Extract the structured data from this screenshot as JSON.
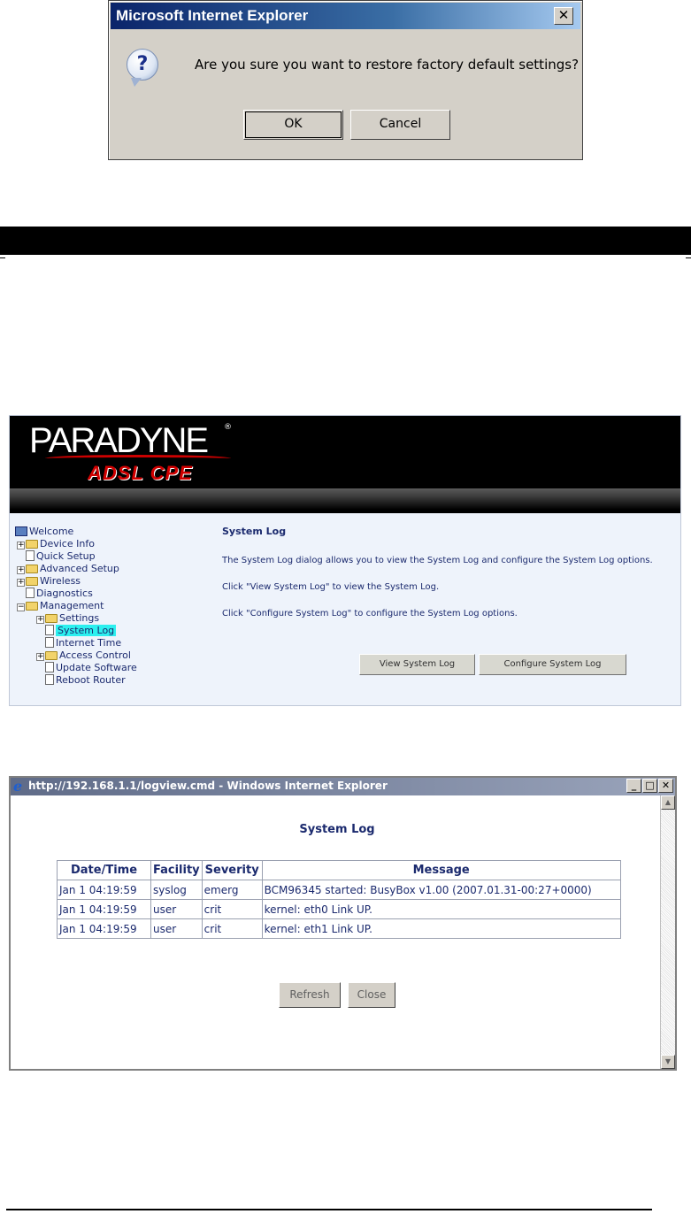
{
  "confirm_dialog": {
    "title": "Microsoft Internet Explorer",
    "close_glyph": "✕",
    "icon": "question-icon",
    "icon_glyph": "?",
    "message": "Are you sure you want to restore factory default settings?",
    "ok_label": "OK",
    "cancel_label": "Cancel"
  },
  "router_ui": {
    "brand": "PARADYNE",
    "brand_mark": "®",
    "product": "ADSL CPE",
    "nav": {
      "welcome": "Welcome",
      "device_info": "Device Info",
      "quick_setup": "Quick Setup",
      "advanced_setup": "Advanced Setup",
      "wireless": "Wireless",
      "diagnostics": "Diagnostics",
      "management": "Management",
      "settings": "Settings",
      "system_log": "System Log",
      "internet_time": "Internet Time",
      "access_control": "Access Control",
      "update_software": "Update Software",
      "reboot_router": "Reboot Router"
    },
    "content": {
      "heading": "System Log",
      "intro": "The System Log dialog allows you to view the System Log and configure the System Log options.",
      "view_hint": "Click \"View System Log\" to view the System Log.",
      "configure_hint": "Click \"Configure System Log\" to configure the System Log options.",
      "view_button": "View System Log",
      "configure_button": "Configure System Log"
    }
  },
  "log_window": {
    "title": "http://192.168.1.1/logview.cmd - Windows Internet Explorer",
    "minimize_glyph": "_",
    "maximize_glyph": "□",
    "close_glyph": "✕",
    "scroll_up_glyph": "▲",
    "scroll_down_glyph": "▼",
    "heading": "System Log",
    "columns": [
      "Date/Time",
      "Facility",
      "Severity",
      "Message"
    ],
    "rows": [
      {
        "datetime": "Jan 1 04:19:59",
        "facility": "syslog",
        "severity": "emerg",
        "message": "BCM96345 started: BusyBox v1.00 (2007.01.31-00:27+0000)"
      },
      {
        "datetime": "Jan 1 04:19:59",
        "facility": "user",
        "severity": "crit",
        "message": "kernel: eth0 Link UP."
      },
      {
        "datetime": "Jan 1 04:19:59",
        "facility": "user",
        "severity": "crit",
        "message": "kernel: eth1 Link UP."
      }
    ],
    "refresh_label": "Refresh",
    "close_label": "Close"
  }
}
